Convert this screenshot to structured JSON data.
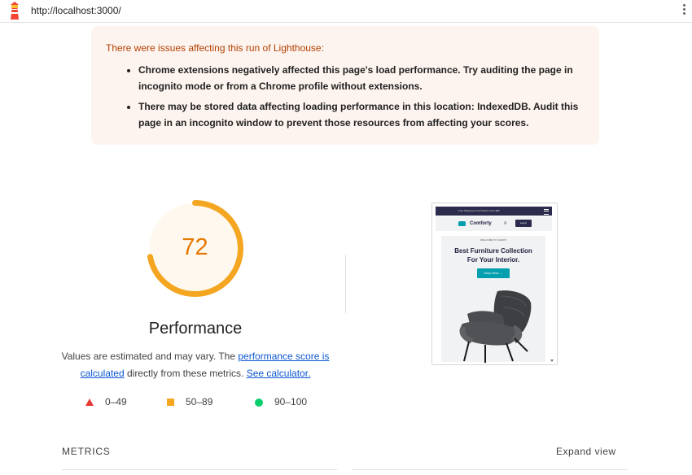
{
  "browser": {
    "url": "http://localhost:3000/",
    "logo_icon": "lighthouse-icon",
    "menu_icon": "kebab-menu-icon"
  },
  "warnings": {
    "title": "There were issues affecting this run of Lighthouse:",
    "items": [
      "Chrome extensions negatively affected this page's load performance. Try auditing the page in incognito mode or from a Chrome profile without extensions.",
      "There may be stored data affecting loading performance in this location: IndexedDB. Audit this page in an incognito window to prevent those resources from affecting your scores."
    ]
  },
  "score": {
    "value": "72",
    "label": "Performance",
    "fraction": 0.72,
    "color": "#f4a621",
    "text_color": "#e67700",
    "bg_color": "#fff8ee"
  },
  "description": {
    "text1": "Values are estimated and may vary. The ",
    "link1": "performance score is calculated",
    "text2": " directly from these metrics. ",
    "link2": "See calculator."
  },
  "legend": {
    "fail": "0–49",
    "average": "50–89",
    "pass": "90–100"
  },
  "preview": {
    "top_banner": "Free Shipping On All Orders Over $50",
    "brand": "Comforty",
    "login": "Log In",
    "welcome": "WELCOME TO CHAIRY",
    "headline_line1": "Best Furniture Collection",
    "headline_line2": "For Your Interior.",
    "shop_button": "Shop Now →"
  },
  "metrics": {
    "heading": "METRICS",
    "expand": "Expand view"
  }
}
